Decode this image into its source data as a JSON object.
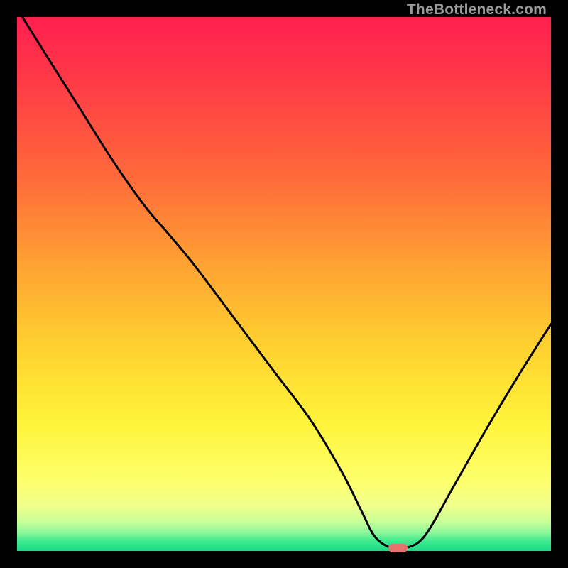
{
  "watermark": {
    "text": "TheBottleneck.com"
  },
  "chart_data": {
    "type": "line",
    "title": "",
    "xlabel": "",
    "ylabel": "",
    "xlim": [
      0,
      100
    ],
    "ylim": [
      0,
      100
    ],
    "grid": false,
    "background_gradient": {
      "stops": [
        {
          "pos": 0.0,
          "color": "#ff1f4f"
        },
        {
          "pos": 0.12,
          "color": "#ff3a47"
        },
        {
          "pos": 0.3,
          "color": "#ff6a3a"
        },
        {
          "pos": 0.46,
          "color": "#ffa133"
        },
        {
          "pos": 0.62,
          "color": "#ffd22f"
        },
        {
          "pos": 0.76,
          "color": "#fff33a"
        },
        {
          "pos": 0.865,
          "color": "#feff6a"
        },
        {
          "pos": 0.915,
          "color": "#f1ff8b"
        },
        {
          "pos": 0.945,
          "color": "#c8ff96"
        },
        {
          "pos": 0.965,
          "color": "#8ff79b"
        },
        {
          "pos": 0.982,
          "color": "#3de98f"
        },
        {
          "pos": 1.0,
          "color": "#18da84"
        }
      ]
    },
    "series": [
      {
        "name": "bottleneck-curve",
        "x": [
          1.0,
          6.0,
          12.0,
          18.0,
          24.0,
          28.0,
          33.0,
          40.0,
          48.0,
          55.0,
          61.0,
          64.5,
          67.0,
          70.0,
          73.0,
          76.5,
          82.0,
          88.0,
          94.0,
          100.0
        ],
        "y": [
          100.0,
          92.0,
          82.5,
          73.0,
          64.5,
          59.8,
          53.8,
          44.5,
          33.8,
          24.5,
          14.5,
          7.5,
          2.7,
          0.6,
          0.6,
          3.0,
          12.5,
          23.0,
          33.0,
          42.5
        ]
      }
    ],
    "marker": {
      "name": "optimal-point",
      "x": 71.4,
      "y": 0.5,
      "width_pct": 3.6,
      "height_pct": 1.6,
      "color": "#e5746f"
    }
  }
}
